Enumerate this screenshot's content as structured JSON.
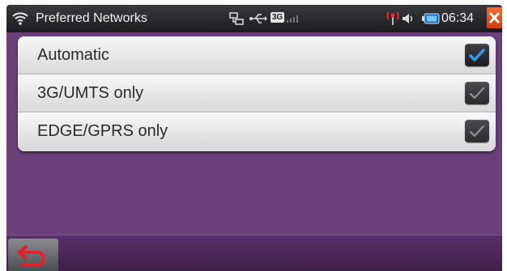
{
  "status_bar": {
    "title": "Preferred Networks",
    "time": "06:34",
    "network_badge": "3G",
    "icons": [
      "wifi-icon",
      "network-icon",
      "usb-icon",
      "3g-signal-icon",
      "no-signal-icon",
      "volume-icon",
      "battery-icon",
      "close-icon"
    ],
    "close_color": "#e84818"
  },
  "options": [
    {
      "label": "Automatic",
      "checked": true
    },
    {
      "label": "3G/UMTS only",
      "checked": false
    },
    {
      "label": "EDGE/GPRS only",
      "checked": false
    }
  ],
  "bottom_bar": {
    "icons": [
      "back-icon"
    ]
  },
  "colors": {
    "background": "#6a3f7a",
    "check_active": "#3b9be8",
    "check_inactive": "#9a9a9a",
    "back_arrow": "#e0202a"
  }
}
